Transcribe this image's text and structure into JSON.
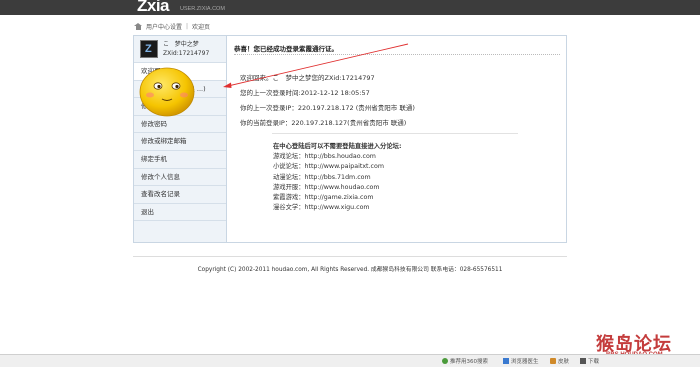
{
  "header": {
    "logo": "Zxia",
    "logo_url": "USER.ZIXIA.COM"
  },
  "breadcrumb": {
    "section": "用户中心设置",
    "separator": "|",
    "current": "欢迎页"
  },
  "profile": {
    "name": "梦中之梦",
    "prefix": "こ",
    "zxid": "ZXid:17214797"
  },
  "sidebar": {
    "items": [
      {
        "label": "欢迎页"
      },
      {
        "label": "绑定帐号(QQ 新浪 ...)"
      },
      {
        "label": "修改名字"
      },
      {
        "label": "修改密码"
      },
      {
        "label": "修改或绑定邮箱"
      },
      {
        "label": "绑定手机"
      },
      {
        "label": "修改个人信息"
      },
      {
        "label": "查看改名记录"
      },
      {
        "label": "退出"
      }
    ]
  },
  "main": {
    "title": "恭喜！您已经成功登录紫霞通行证。",
    "info": {
      "welcome": "欢迎回来。こ　梦中之梦您的ZXid:17214797",
      "last_login_time": "您的上一次登录时间:2012-12-12 18:05:57",
      "last_login_ip": "你的上一次登录IP：220.197.218.172 (贵州省贵阳市 联通)",
      "current_ip": "你的当前登录IP：220.197.218.127(贵州省贵阳市 联通)"
    },
    "forum_title": "在中心登陆后可以不需要登陆直接进入分论坛:",
    "forums": [
      "游戏论坛：http://bbs.houdao.com",
      "小说论坛：http://www.paipaitxt.com",
      "动漫论坛：http://bbs.71dm.com",
      "游戏开服：http://www.houdao.com",
      "紫霞游戏：http://game.zixia.com",
      "漫谷文学：http://www.xigu.com"
    ]
  },
  "footer": {
    "copyright": "Copyright (C) 2002-2011 houdao.com, All Rights Reserved. 成都猴岛科技有限公司 联系电话：028-65576511"
  },
  "statusbar": {
    "items": [
      "推荐用360搜索",
      "浏览器医生",
      "皮肤",
      "下载"
    ]
  },
  "watermark": {
    "text": "猴岛论坛",
    "url": "BBS.HOUDAO.COM"
  },
  "colors": {
    "topbar": "#3c3c3c",
    "sidebar": "#eef3f8",
    "border": "#c9d6e3",
    "arrow": "#e03030",
    "smiley": "#f5c400"
  }
}
